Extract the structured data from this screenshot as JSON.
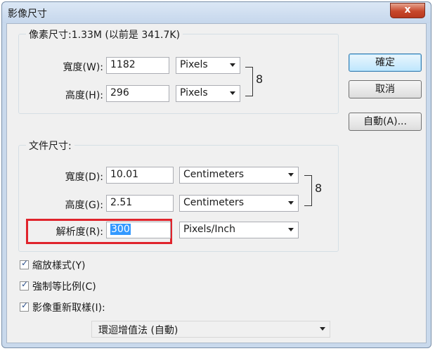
{
  "window": {
    "title": "影像尺寸",
    "close_label": "x"
  },
  "pixel_dims": {
    "legend": "像素尺寸:1.33M (以前是 341.7K)",
    "width_label": "寬度(W):",
    "width_value": "1182",
    "width_unit": "Pixels",
    "height_label": "高度(H):",
    "height_value": "296",
    "height_unit": "Pixels"
  },
  "doc_size": {
    "legend": "文件尺寸:",
    "width_label": "寬度(D):",
    "width_value": "10.01",
    "width_unit": "Centimeters",
    "height_label": "高度(G):",
    "height_value": "2.51",
    "height_unit": "Centimeters",
    "res_label": "解析度(R):",
    "res_value": "300",
    "res_unit": "Pixels/Inch"
  },
  "link_icon": "link-chain-icon",
  "buttons": {
    "ok": "確定",
    "cancel": "取消",
    "auto": "自動(A)..."
  },
  "options": {
    "scale_styles": {
      "label": "縮放樣式(Y)",
      "checked": true
    },
    "constrain": {
      "label": "強制等比例(C)",
      "checked": true
    },
    "resample": {
      "label": "影像重新取樣(I):",
      "checked": true
    },
    "resample_method": "環迴增值法 (自動)"
  },
  "check_glyph": "✓",
  "link_glyph": "8",
  "colors": {
    "highlight": "#e0242c",
    "selection": "#3399ff"
  }
}
